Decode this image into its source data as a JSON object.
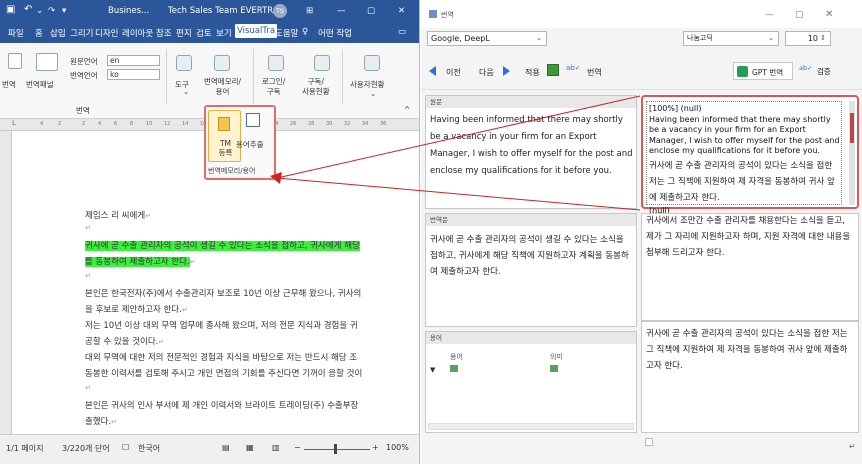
{
  "word": {
    "title": {
      "doc_name": "Busines...",
      "team": "Tech Sales Team EVERTRAN",
      "user_initials": "TS"
    },
    "menu": [
      "파일",
      "홈",
      "삽입",
      "그리기",
      "디자인",
      "레이아웃",
      "참조",
      "편지",
      "검토",
      "보기",
      "VisualTra",
      "도움말",
      "어떤 작업"
    ],
    "ribbon": {
      "translate_label": "번역",
      "translate_panel_label": "번역패널",
      "source_lang_label": "원문언어",
      "source_lang_value": "en",
      "target_lang_label": "번역언어",
      "target_lang_value": "ko",
      "tool_label": "도구",
      "memory_label": "번역메모리/\n용어",
      "login_label": "로그인/\n구독",
      "subscribe_label": "구독/\n사용현황",
      "usage_label": "사용자현황",
      "group_label": "번역",
      "tm_register": "TM\n등록",
      "term_extract": "용어추출",
      "popup_group": "번역메모리/용어"
    },
    "ruler": [
      "4",
      "2",
      "2",
      "4",
      "6",
      "8",
      "10",
      "12",
      "14",
      "16",
      "18",
      "20",
      "22",
      "24",
      "26",
      "28",
      "30",
      "32",
      "34",
      "36"
    ],
    "doc": {
      "line1": "제임스 리 씨에게",
      "line2": "귀사에 곧 수출 관리자의 공석이 생길 수 있다는 소식을 접하고, 귀사에게 해당",
      "line3": "를 동봉하여 제출하고자 한다.",
      "line4": "본인은 한국전자(주)에서 수출관리자 보조로 10년 이상 근무해 왔으나, 귀사의",
      "line5": "을 후보로 제안하고자 한다.",
      "line6": "저는 10년 이상 대외 무역 업무에 종사해 왔으며, 저의 전문 지식과 경험을 귀",
      "line7": "공할 수 있을 것이다.",
      "line8": "대외 무역에 대한 저의 전문적인 경험과 지식을 바탕으로 저는 반드시 해당 조",
      "line9": "동봉한 이력서를 검토해 주시고 개인 면접의 기회를 주신다면 기꺼이 응할 것이",
      "line10": "본인은 귀사의 인사 부서에 제 개인 이력서와 브라이트 트레이딩(주) 수출부장",
      "line11": "출했다."
    },
    "status": {
      "page": "1/1 페이지",
      "words": "3/220개 단어",
      "lang": "한국어",
      "zoom": "100%"
    }
  },
  "panel": {
    "title": "번역",
    "engine": "Google, DeepL",
    "font": "나눔고딕",
    "font_size": "10",
    "buttons": {
      "prev": "이전",
      "next": "다음",
      "apply": "적용",
      "translate": "번역",
      "gpt": "GPT 번역",
      "review": "검증"
    },
    "source_head": "원문",
    "source_text": "Having been informed that there may shortly be a vacancy in your firm for an Export Manager, I wish to offer myself for the post and enclose my qualifications for it before you.",
    "target_head": "번역문",
    "target_text": "귀사에 곧 수출 관리자의 공석이 생길 수 있다는 소식을 접하고, 귀사에게 해당 직책에 지원하고자 계획을 동봉하여 제출하고자 한다.",
    "glossary_head": "용어",
    "glossary_col_term": "용어",
    "glossary_col_meaning": "의미",
    "tm_header": "[100%] (null)",
    "tm_source": "Having been informed that there may shortly be a vacancy in your firm for an Export Manager, I wish to offer myself for the post and enclose my qualifications for it before you.",
    "tm_target": "귀사에 곧 수출 관리자의 공석이 있다는 소식을 접한 저는 그 직책에 지원하여 제 자격을 동봉하여 귀사 앞에 제출하고자 한다.",
    "tm_null": "(null)",
    "alt1": "귀사에서 조만간 수출 관리자를 채용한다는 소식을 듣고, 제가 그 자리에 지원하고자 하며, 지원 자격에 대한 내용을 첨부해 드리고자 한다.",
    "alt2": "귀사에 곧 수출 관리자의 공석이 있다는 소식을 접한 저는 그 직책에 지원하여 제 자격을 동봉하여 귀사 앞에 제출하고자 한다."
  }
}
